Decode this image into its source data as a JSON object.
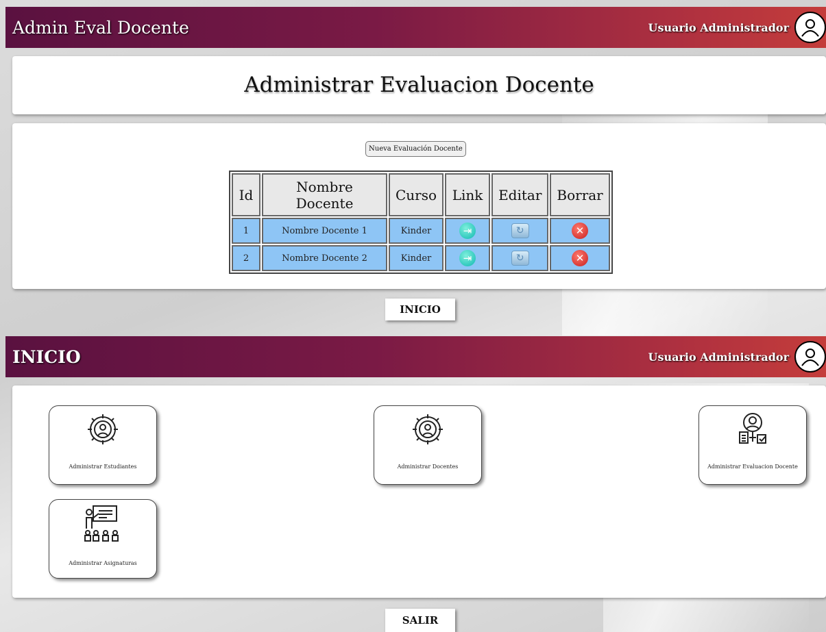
{
  "screen1": {
    "app_title": "Admin Eval Docente",
    "user_label": "Usuario Administrador",
    "page_heading": "Administrar Evaluacion Docente",
    "new_button": "Nueva Evaluación Docente",
    "table": {
      "columns": [
        "Id",
        "Nombre Docente",
        "Curso",
        "Link",
        "Editar",
        "Borrar"
      ],
      "rows": [
        {
          "id": "1",
          "nombre": "Nombre Docente 1",
          "curso": "Kinder"
        },
        {
          "id": "2",
          "nombre": "Nombre Docente 2",
          "curso": "Kinder"
        }
      ],
      "icons": {
        "link": "enter-icon",
        "edit": "refresh-edit-icon",
        "delete": "delete-x-icon"
      }
    },
    "nav_button": "INICIO"
  },
  "screen2": {
    "app_title": "INICIO",
    "user_label": "Usuario Administrador",
    "cards": [
      {
        "label": "Administrar Estudiantes",
        "icon": "gear-person-icon"
      },
      {
        "label": "Administrar Docentes",
        "icon": "gear-person-icon"
      },
      {
        "label": "Administrar Evaluacion Docente",
        "icon": "evaluation-person-icon"
      },
      {
        "label": "Administrar Asignaturas",
        "icon": "classroom-icon"
      }
    ],
    "nav_button": "SALIR"
  },
  "colors": {
    "header_start": "#5a1140",
    "header_end": "#c43d3b",
    "table_row": "#8ec5f5"
  }
}
